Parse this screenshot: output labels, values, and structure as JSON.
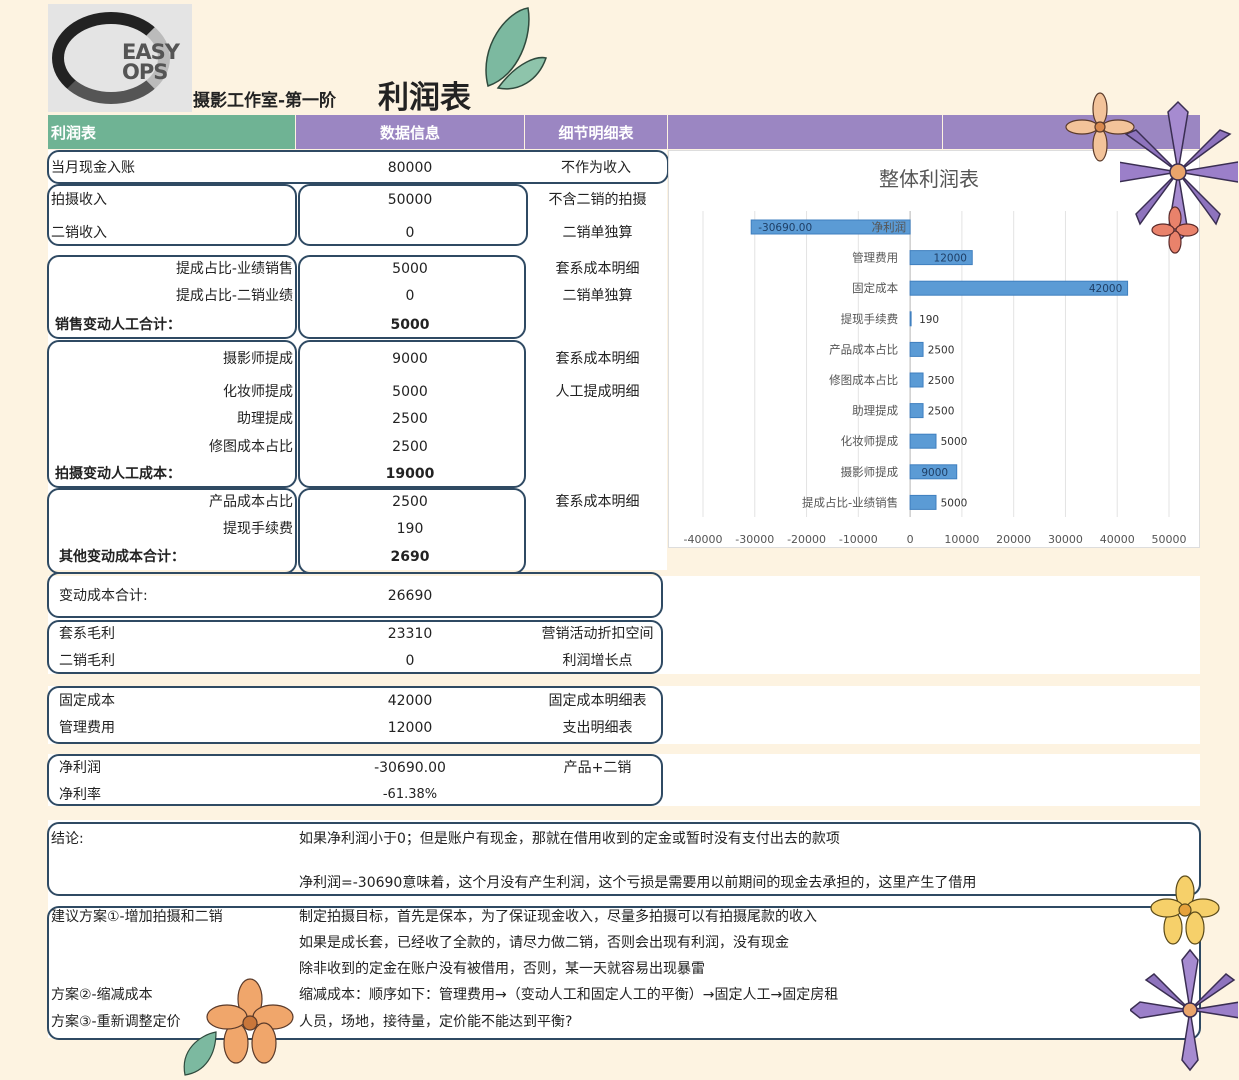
{
  "logo": {
    "line1": "EASY",
    "line2": "OPS"
  },
  "header": {
    "subtitle": "摄影工作室-第一阶",
    "title": "利润表"
  },
  "columns": [
    "利润表",
    "数据信息",
    "细节明细表"
  ],
  "rows": {
    "cash_in": {
      "label": "当月现金入账",
      "value": "80000",
      "note": "不作为收入"
    },
    "shoot_income": {
      "label": "拍摄收入",
      "value": "50000",
      "note": "不含二销的拍摄"
    },
    "resale_income": {
      "label": "二销收入",
      "value": "0",
      "note": "二销单独算"
    },
    "commission_sales": {
      "label": "提成占比-业绩销售",
      "value": "5000",
      "note": "套系成本明细"
    },
    "commission_resale": {
      "label": "提成占比-二销业绩",
      "value": "0",
      "note": "二销单独算"
    },
    "sales_total": {
      "label": "销售变动人工合计：",
      "value": "5000"
    },
    "photographer": {
      "label": "摄影师提成",
      "value": "9000",
      "note": "套系成本明细"
    },
    "makeup": {
      "label": "化妆师提成",
      "value": "5000",
      "note": "人工提成明细"
    },
    "assistant": {
      "label": "助理提成",
      "value": "2500"
    },
    "retouch": {
      "label": "修图成本占比",
      "value": "2500"
    },
    "shoot_total": {
      "label": "拍摄变动人工成本：",
      "value": "19000"
    },
    "product": {
      "label": "产品成本占比",
      "value": "2500",
      "note": "套系成本明细"
    },
    "withdraw_fee": {
      "label": "提现手续费",
      "value": "190"
    },
    "other_total": {
      "label": "其他变动成本合计：",
      "value": "2690"
    },
    "variable_total": {
      "label": "变动成本合计:",
      "value": "26690"
    },
    "package_margin": {
      "label": "套系毛利",
      "value": "23310",
      "note": "营销活动折扣空间"
    },
    "resale_margin": {
      "label": "二销毛利",
      "value": "0",
      "note": "利润增长点"
    },
    "fixed_cost": {
      "label": "固定成本",
      "value": "42000",
      "note": "固定成本明细表"
    },
    "admin_cost": {
      "label": "管理费用",
      "value": "12000",
      "note": "支出明细表"
    },
    "net_profit": {
      "label": "净利润",
      "value": "-30690.00",
      "note": "产品+二销"
    },
    "net_margin": {
      "label": "净利率",
      "value": "-61.38%"
    }
  },
  "conclusion": {
    "label": "结论:",
    "line1": "如果净利润小于0；但是账户有现金，那就在借用收到的定金或暂时没有支付出去的款项",
    "line2": "净利润=-30690意味着，这个月没有产生利润，这个亏损是需要用以前期间的现金去承担的，这里产生了借用"
  },
  "plans": {
    "plan1": "建议方案①-增加拍摄和二销",
    "plan2": "方案②-缩减成本",
    "plan3": "方案③-重新调整定价",
    "text1": "制定拍摄目标，首先是保本，为了保证现金收入，尽量多拍摄可以有拍摄尾款的收入",
    "text2": "如果是成长套，已经收了全款的，请尽力做二销，否则会出现有利润，没有现金",
    "text3": "除非收到的定金在账户没有被借用，否则，某一天就容易出现暴雷",
    "text4": "缩减成本：顺序如下：管理费用→（变动人工和固定人工的平衡）→固定人工→固定房租",
    "text5": "人员，场地，接待量，定价能不能达到平衡?"
  },
  "colors": {
    "header_green": "#6fb394",
    "header_purple": "#9b86c2",
    "bar": "#5b9bd5",
    "box_border": "#2f4a63"
  },
  "chart_data": {
    "type": "bar",
    "orientation": "horizontal",
    "title": "整体利润表",
    "categories": [
      "净利润",
      "管理费用",
      "固定成本",
      "提现手续费",
      "产品成本占比",
      "修图成本占比",
      "助理提成",
      "化妆师提成",
      "摄影师提成",
      "提成占比-业绩销售"
    ],
    "values": [
      -30690,
      12000,
      42000,
      190,
      2500,
      2500,
      2500,
      5000,
      9000,
      5000
    ],
    "value_labels": [
      "-30690.00",
      "12000",
      "42000",
      "190",
      "2500",
      "2500",
      "2500",
      "5000",
      "9000",
      "5000"
    ],
    "xlim": [
      -40000,
      50000
    ],
    "xticks": [
      "-40000",
      "-30000",
      "-20000",
      "-10000",
      "0",
      "10000",
      "20000",
      "30000",
      "40000",
      "50000"
    ],
    "grid": true
  }
}
